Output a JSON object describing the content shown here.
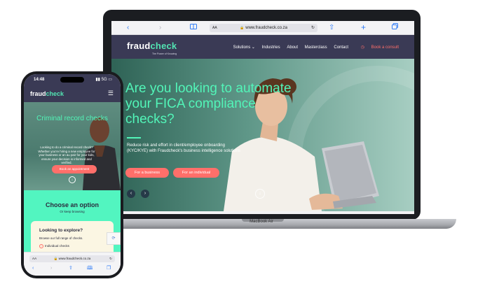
{
  "laptop": {
    "model_label": "MacBook Air",
    "browser": {
      "address_text": "www.fraudcheck.co.za",
      "text_size_label": "AA",
      "icons": [
        "back-icon",
        "forward-icon",
        "sidebar-icon",
        "lock-icon",
        "reload-icon",
        "share-icon",
        "new-tab-icon",
        "tabs-icon"
      ]
    },
    "site": {
      "logo_part1": "fraud",
      "logo_part2": "check",
      "logo_tagline": "The Power of Knowing",
      "nav": [
        "Solutions ⌄",
        "Industries",
        "About",
        "Masterclass",
        "Contact"
      ],
      "consult_label": "Book a consult",
      "hero_title": "Are you looking to automate your FICA compliance checks?",
      "hero_subtitle": "Reduce risk and effort in client/employee onboarding (KYC/KYE) with Fraudcheck's business intelligence solutions",
      "btn_business": "For a business",
      "btn_individual": "For an individual",
      "recaptcha_icon": "recaptcha-icon"
    }
  },
  "phone": {
    "status": {
      "time": "14:48",
      "network": "5G"
    },
    "site": {
      "logo_part1": "fraud",
      "logo_part2": "check",
      "hero_title": "Criminal record checks",
      "hero_subtitle": "Looking to do a criminal record check? Whether you're hiring a new employee for your business or an au pair for your kids, ensure your decision is informed and verified.",
      "appointment_label": "Book an appointment",
      "choose_title": "Choose an option",
      "choose_subtitle": "Or keep browsing",
      "card_title": "Looking to explore?",
      "card_subtitle": "Browse our full range of checks.",
      "card_item": "Individual checks"
    },
    "browser": {
      "address_text": "www.fraudcheck.co.za",
      "text_size_label": "AA"
    }
  },
  "colors": {
    "nav_bg": "#3a3a55",
    "accent_green": "#52f5b8",
    "accent_coral": "#ff6f6a"
  }
}
